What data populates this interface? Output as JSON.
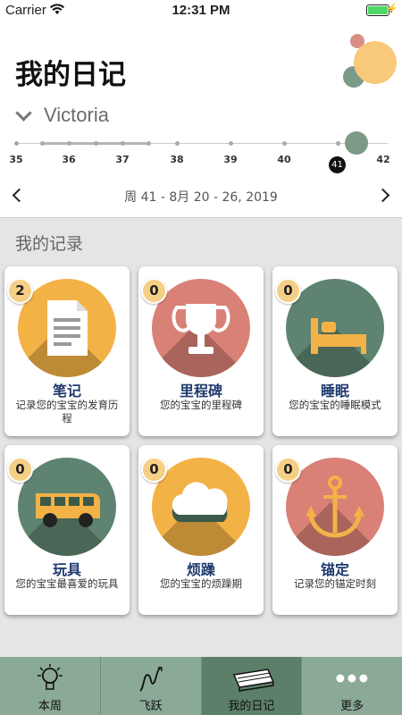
{
  "status_bar": {
    "carrier": "Carrier",
    "time": "12:31 PM"
  },
  "header": {
    "title": "我的日记",
    "child_name": "Victoria",
    "timeline": {
      "weeks": [
        "35",
        "36",
        "37",
        "38",
        "39",
        "40",
        "41",
        "42"
      ],
      "current_week": "41"
    },
    "week_range": "周 41 - 8月 20 - 26, 2019"
  },
  "section_title": "我的记录",
  "cards": [
    {
      "count": "2",
      "name": "笔记",
      "desc": "记录您的宝宝的发育历程",
      "icon": "note-icon",
      "color": "#f3b246"
    },
    {
      "count": "0",
      "name": "里程碑",
      "desc": "您的宝宝的里程碑",
      "icon": "trophy-icon",
      "color": "#d98176"
    },
    {
      "count": "0",
      "name": "睡眠",
      "desc": "您的宝宝的睡眠模式",
      "icon": "bed-icon",
      "color": "#5e8370"
    },
    {
      "count": "0",
      "name": "玩具",
      "desc": "您的宝宝最喜爱的玩具",
      "icon": "bus-icon",
      "color": "#5e8370"
    },
    {
      "count": "0",
      "name": "烦躁",
      "desc": "您的宝宝的烦躁期",
      "icon": "cloud-icon",
      "color": "#f3b246"
    },
    {
      "count": "0",
      "name": "锚定",
      "desc": "记录您的锚定时刻",
      "icon": "anchor-icon",
      "color": "#d98176"
    }
  ],
  "tabs": [
    {
      "label": "本周",
      "icon": "lightbulb-icon"
    },
    {
      "label": "飞跃",
      "icon": "leap-icon"
    },
    {
      "label": "我的日记",
      "icon": "diary-book-icon",
      "active": true
    },
    {
      "label": "更多",
      "icon": "more-dots-icon"
    }
  ],
  "colors": {
    "accent_green": "#5b7f69",
    "tab_bar": "#8aa996",
    "badge": "#f6cf87",
    "card_title": "#1f3a6e"
  }
}
